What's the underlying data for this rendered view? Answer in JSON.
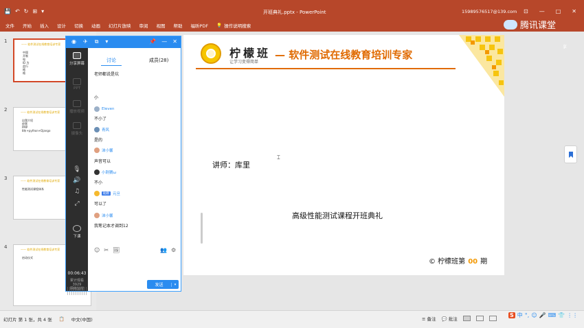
{
  "titlebar": {
    "quick_access": [
      "💾",
      "↶",
      "↻",
      "⊞",
      "▾"
    ],
    "document_title": "开班典礼.pptx - PowerPoint",
    "account": "15989576517@139.com",
    "window_controls": [
      "⊡",
      "—",
      "□",
      "✕"
    ]
  },
  "ribbon": {
    "tabs": [
      "文件",
      "开始",
      "插入",
      "设计",
      "切换",
      "动画",
      "幻灯片放映",
      "审阅",
      "视图",
      "帮助",
      "福昕PDF"
    ],
    "tell_me": "操作说明搜索",
    "share": "共享",
    "brand": "腾讯课堂"
  },
  "thumbnails": [
    {
      "num": "1",
      "head": "—— 软件测试在线教育培训专家",
      "body": "中国\n开制\n电\nID 为\n此行\n格\n格\n"
    },
    {
      "num": "2",
      "head": "—— 软件测试在线教育培训专家",
      "body": "自我介绍\n  经营\n  PMP\n  8年+python+Django"
    },
    {
      "num": "3",
      "head": "—— 软件测试在线教育培训专家",
      "body": "性能测试课程体系"
    },
    {
      "num": "4",
      "head": "—— 软件测试在线教育培训专家",
      "body": "启动仪式"
    }
  ],
  "slide": {
    "logo_name": "柠檬班",
    "logo_slogan": "让学习变得简单",
    "tagline": "— 软件测试在线教育培训专家",
    "lecturer": "讲师：库里",
    "course": "高级性能测试课程开班典礼",
    "footer_prefix": "© 柠檬班第",
    "footer_num": "00",
    "footer_suffix": "期"
  },
  "panel": {
    "top_icons": [
      "◉",
      "✈",
      "⧉",
      "▾"
    ],
    "controls": [
      "📌",
      "—",
      "✕"
    ],
    "side": {
      "share_screen": "分享屏幕",
      "ppt": "PPT",
      "play_video": "播放视频",
      "camera": "摄像头",
      "end_class": "下课",
      "timer": "00:06:43",
      "stats_label": "累计观看",
      "stats_value": "3929",
      "network": "网络监控"
    },
    "tabs": {
      "discussion": "讨论",
      "members": "成员(28)"
    },
    "messages": [
      {
        "type": "text",
        "text": "老师都说是坑"
      },
      {
        "type": "text",
        "text": "小"
      },
      {
        "type": "user",
        "name": "Eleven"
      },
      {
        "type": "text",
        "text": "不小了"
      },
      {
        "type": "user",
        "name": "青风"
      },
      {
        "type": "text",
        "text": "是的"
      },
      {
        "type": "user",
        "name": "沫小馨"
      },
      {
        "type": "text",
        "text": "声音可以"
      },
      {
        "type": "user",
        "name": "小刺猬ω"
      },
      {
        "type": "text",
        "text": "不小"
      },
      {
        "type": "user",
        "name": "元旦",
        "tag": "助教"
      },
      {
        "type": "text",
        "text": "可以了"
      },
      {
        "type": "user",
        "name": "沫小馨"
      },
      {
        "type": "text",
        "text": "我笔记本才调到12"
      }
    ],
    "tools_left": [
      "☺",
      "✂",
      "🖼"
    ],
    "tools_right": [
      "👥",
      "⚙"
    ],
    "send": "发送",
    "send_arrow": "▾"
  },
  "statusbar": {
    "slide_info": "幻灯片 第 1 张，共 4 张",
    "language": "中文(中国)",
    "notes": "备注",
    "comments": "批注"
  },
  "colors": {
    "office_red": "#b7472a",
    "tencent_blue": "#2a8cf0",
    "lemon_orange": "#e06a00"
  }
}
